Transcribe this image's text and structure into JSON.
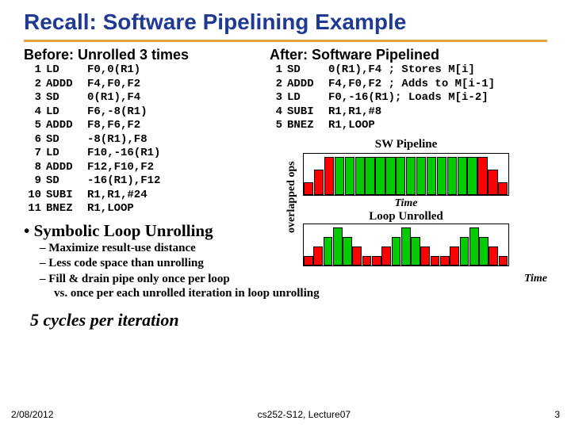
{
  "title": "Recall: Software Pipelining Example",
  "before": {
    "heading": "Before: Unrolled 3 times",
    "rows": [
      {
        "n": "1",
        "op": "LD",
        "args": "F0,0(R1)"
      },
      {
        "n": "2",
        "op": "ADDD",
        "args": "F4,F0,F2"
      },
      {
        "n": "3",
        "op": "SD",
        "args": "0(R1),F4"
      },
      {
        "n": "4",
        "op": "LD",
        "args": "F6,-8(R1)"
      },
      {
        "n": "5",
        "op": "ADDD",
        "args": "F8,F6,F2"
      },
      {
        "n": "6",
        "op": "SD",
        "args": "-8(R1),F8"
      },
      {
        "n": "7",
        "op": "LD",
        "args": "F10,-16(R1)"
      },
      {
        "n": "8",
        "op": "ADDD",
        "args": "F12,F10,F2"
      },
      {
        "n": "9",
        "op": "SD",
        "args": "-16(R1),F12"
      },
      {
        "n": "10",
        "op": "SUBI",
        "args": "R1,R1,#24"
      },
      {
        "n": "11",
        "op": "BNEZ",
        "args": "R1,LOOP"
      }
    ]
  },
  "after": {
    "heading": "After: Software Pipelined",
    "rows": [
      {
        "n": "1",
        "op": "SD",
        "args": "0(R1),F4 ; Stores M[i]"
      },
      {
        "n": "2",
        "op": "ADDD",
        "args": "F4,F0,F2 ; Adds to M[i-1]"
      },
      {
        "n": "3",
        "op": "LD",
        "args": "F0,-16(R1); Loads M[i-2]"
      },
      {
        "n": "4",
        "op": "SUBI",
        "args": "R1,R1,#8"
      },
      {
        "n": "5",
        "op": "BNEZ",
        "args": "R1,LOOP"
      }
    ]
  },
  "bullet_main": "Symbolic Loop Unrolling",
  "sub": {
    "b1": "Maximize result-use distance",
    "b2": "Less code space than unrolling",
    "b3": "Fill & drain pipe only once per loop",
    "vs": "vs. once per each unrolled iteration in loop unrolling"
  },
  "cycles": "5 cycles per iteration",
  "diagram": {
    "ylabel": "overlapped ops",
    "sw_title": "SW Pipeline",
    "unrolled_title": "Loop Unrolled",
    "time": "Time"
  },
  "footer": {
    "date": "2/08/2012",
    "center": "cs252-S12, Lecture07",
    "page": "3"
  }
}
